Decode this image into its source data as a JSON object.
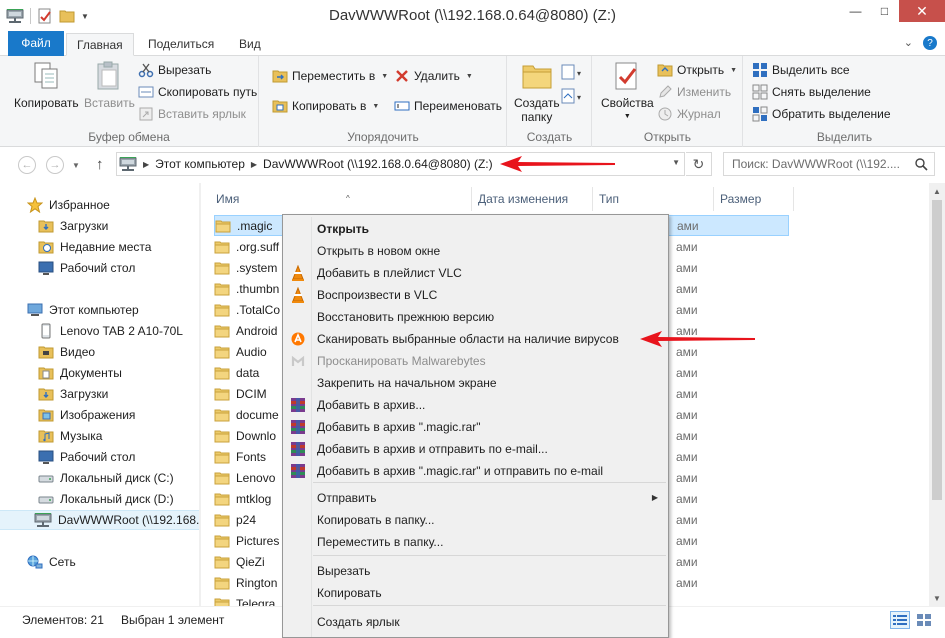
{
  "window": {
    "title": "DavWWWRoot (\\\\192.168.0.64@8080) (Z:)",
    "minimize": "—",
    "maximize": "□",
    "close": "✕"
  },
  "tabs": {
    "file": "Файл",
    "home": "Главная",
    "share": "Поделиться",
    "view": "Вид"
  },
  "ribbon": {
    "clipboard": {
      "label": "Буфер обмена",
      "copy": "Копировать",
      "paste": "Вставить",
      "cut": "Вырезать",
      "copy_path": "Скопировать путь",
      "paste_shortcut": "Вставить ярлык"
    },
    "organize": {
      "label": "Упорядочить",
      "move_to": "Переместить в",
      "copy_to": "Копировать в",
      "delete": "Удалить",
      "rename": "Переименовать"
    },
    "new": {
      "label": "Создать",
      "new_folder_line1": "Создать",
      "new_folder_line2": "папку"
    },
    "open": {
      "label": "Открыть",
      "properties": "Свойства",
      "open": "Открыть",
      "edit": "Изменить",
      "history": "Журнал"
    },
    "select": {
      "label": "Выделить",
      "select_all": "Выделить все",
      "select_none": "Снять выделение",
      "invert": "Обратить выделение"
    }
  },
  "address": {
    "crumbs": [
      "Этот компьютер",
      "DavWWWRoot (\\\\192.168.0.64@8080) (Z:)"
    ],
    "search_placeholder": "Поиск: DavWWWRoot (\\\\192...."
  },
  "navpane": {
    "items": [
      {
        "label": "Избранное",
        "icon": "star-icon",
        "indent": 0
      },
      {
        "label": "Загрузки",
        "icon": "downloads-icon",
        "indent": 1
      },
      {
        "label": "Недавние места",
        "icon": "recent-icon",
        "indent": 1
      },
      {
        "label": "Рабочий стол",
        "icon": "desktop-icon",
        "indent": 1
      },
      {
        "label": "Этот компьютер",
        "icon": "computer-icon",
        "indent": 0
      },
      {
        "label": "Lenovo TAB 2 A10-70L",
        "icon": "device-icon",
        "indent": 1
      },
      {
        "label": "Видео",
        "icon": "videos-icon",
        "indent": 1
      },
      {
        "label": "Документы",
        "icon": "documents-icon",
        "indent": 1
      },
      {
        "label": "Загрузки",
        "icon": "downloads-icon",
        "indent": 1
      },
      {
        "label": "Изображения",
        "icon": "pictures-icon",
        "indent": 1
      },
      {
        "label": "Музыка",
        "icon": "music-icon",
        "indent": 1
      },
      {
        "label": "Рабочий стол",
        "icon": "desktop-icon",
        "indent": 1
      },
      {
        "label": "Локальный диск (C:)",
        "icon": "drive-icon",
        "indent": 1
      },
      {
        "label": "Локальный диск (D:)",
        "icon": "drive-icon",
        "indent": 1
      },
      {
        "label": "DavWWWRoot (\\\\192.168.0.",
        "icon": "network-drive-icon",
        "indent": 1
      },
      {
        "label": "Сеть",
        "icon": "network-icon",
        "indent": 0
      }
    ]
  },
  "filelist": {
    "columns": [
      "Имя",
      "Дата изменения",
      "Тип",
      "Размер"
    ],
    "type_fragment": "ами",
    "files": [
      ".magic",
      ".org.suff",
      ".system",
      ".thumbn",
      ".TotalCo",
      "Android",
      "Audio",
      "data",
      "DCIM",
      "docume",
      "Downlo",
      "Fonts",
      "Lenovo",
      "mtklog",
      "p24",
      "Pictures",
      "QieZi",
      "Rington",
      "Telegra"
    ]
  },
  "context_menu": {
    "items": [
      {
        "label": "Открыть",
        "icon": "",
        "bold": true
      },
      {
        "label": "Открыть в новом окне",
        "icon": ""
      },
      {
        "label": "Добавить в плейлист VLC",
        "icon": "vlc-icon"
      },
      {
        "label": "Воспроизвести в VLC",
        "icon": "vlc-icon"
      },
      {
        "label": "Восстановить прежнюю версию",
        "icon": ""
      },
      {
        "label": "Сканировать выбранные области на наличие вирусов",
        "icon": "avast-icon"
      },
      {
        "label": "Просканировать Malwarebytes",
        "icon": "malwarebytes-icon",
        "dim": true
      },
      {
        "label": "Закрепить на начальном экране",
        "icon": ""
      },
      {
        "label": "Добавить в архив...",
        "icon": "winrar-icon"
      },
      {
        "label": "Добавить в архив \".magic.rar\"",
        "icon": "winrar-icon"
      },
      {
        "label": "Добавить в архив и отправить по e-mail...",
        "icon": "winrar-icon"
      },
      {
        "label": "Добавить в архив \".magic.rar\" и отправить по e-mail",
        "icon": "winrar-icon"
      },
      {
        "label": "Отправить",
        "icon": "",
        "submenu": true
      },
      {
        "label": "Копировать в папку...",
        "icon": ""
      },
      {
        "label": "Переместить в папку...",
        "icon": ""
      },
      {
        "label": "Вырезать",
        "icon": ""
      },
      {
        "label": "Копировать",
        "icon": ""
      },
      {
        "label": "Создать ярлык",
        "icon": ""
      }
    ]
  },
  "statusbar": {
    "count": "Элементов: 21",
    "selected": "Выбран 1 элемент"
  },
  "colors": {
    "accent": "#1979ca",
    "selection": "#cce8ff",
    "arrow": "#e8141c"
  }
}
